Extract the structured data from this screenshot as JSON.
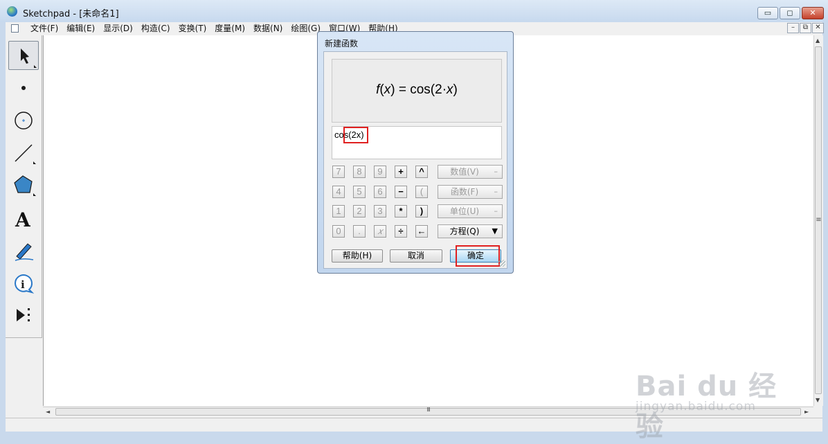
{
  "window": {
    "title": "Sketchpad  - [未命名1]",
    "controls": {
      "minimize": "▭",
      "maximize": "◻",
      "close": "✕"
    }
  },
  "menu": {
    "items": [
      "文件(F)",
      "编辑(E)",
      "显示(D)",
      "构造(C)",
      "变换(T)",
      "度量(M)",
      "数据(N)",
      "绘图(G)",
      "窗口(W)",
      "帮助(H)"
    ],
    "mdi_controls": {
      "minimize": "–",
      "restore": "⧉",
      "close": "✕"
    }
  },
  "toolbox": {
    "tools": [
      {
        "name": "arrow-tool-icon",
        "selected": true
      },
      {
        "name": "point-tool-icon"
      },
      {
        "name": "compass-tool-icon"
      },
      {
        "name": "straightedge-tool-icon"
      },
      {
        "name": "polygon-tool-icon"
      },
      {
        "name": "text-tool-icon",
        "glyph": "A"
      },
      {
        "name": "marker-tool-icon"
      },
      {
        "name": "information-tool-icon",
        "glyph": "i"
      },
      {
        "name": "custom-tool-icon"
      }
    ]
  },
  "dialog": {
    "title": "新建函数",
    "preview": {
      "f": "f",
      "x1": "x",
      "rest": " = cos(2·",
      "x2": "x",
      "close": ")",
      "lparen": "(",
      "rparen": ")"
    },
    "input_value": "cos(2x)",
    "keypad": {
      "rows": [
        [
          "7",
          "8",
          "9",
          "+",
          "^"
        ],
        [
          "4",
          "5",
          "6",
          "−",
          "("
        ],
        [
          "1",
          "2",
          "3",
          "*",
          ")"
        ],
        [
          "0",
          ".",
          "𝑥",
          "÷",
          "←"
        ]
      ]
    },
    "side_buttons": [
      {
        "label": "数值(V)",
        "marker": "–",
        "enabled": false
      },
      {
        "label": "函数(F)",
        "marker": "–",
        "enabled": false
      },
      {
        "label": "单位(U)",
        "marker": "–",
        "enabled": false
      },
      {
        "label": "方程(Q)",
        "marker": "▼",
        "enabled": true
      }
    ],
    "buttons": {
      "help": "帮助(H)",
      "cancel": "取消",
      "ok": "确定"
    }
  },
  "scrollbars": {
    "grip": "≡",
    "hgrip": "III",
    "up": "▲",
    "down": "▼",
    "left": "◄",
    "right": "►"
  },
  "watermark": {
    "logo": "Bai du 经验",
    "url": "jingyan.baidu.com"
  }
}
